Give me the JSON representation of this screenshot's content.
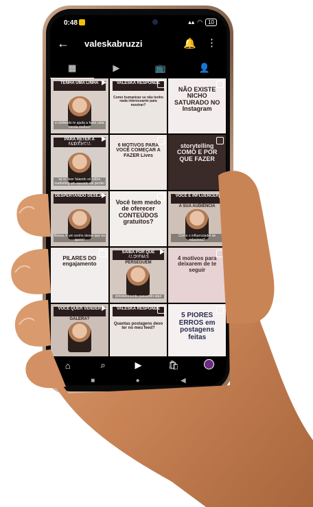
{
  "status": {
    "time": "0:48",
    "battery": "10"
  },
  "header": {
    "username": "valeskabruzzi",
    "back_icon": "←",
    "bell_icon": "🔔",
    "more_icon": "⋮"
  },
  "tabs": [
    {
      "name": "grid",
      "icon": "▦"
    },
    {
      "name": "reels",
      "icon": "▶"
    },
    {
      "name": "igtv",
      "icon": "📺"
    },
    {
      "name": "tagged",
      "icon": "👤"
    }
  ],
  "posts": [
    {
      "band": "TENHA UMA LINHA",
      "band2": "ATRAVÉS DO CONTEÚDO",
      "caption": "o conteúdo te ajuda a fazer uma venda melhor!",
      "bg": "#d9cfc8",
      "type": "photo"
    },
    {
      "band": "VALESKA RESPONDE",
      "big": "Como humanizar se não tenho nada interessante para mostrar?",
      "bg": "#ece6e3",
      "type": "text",
      "bigcolor": "#2b1d1d",
      "bigsize": 5
    },
    {
      "big": "NÃO EXISTE NICHO SATURADO NO Instagram",
      "bg": "#f3eded",
      "type": "text",
      "bigcolor": "#2b1d1d",
      "bigsize": 9
    },
    {
      "band": "PARA RETER A AUDIÊNCIA",
      "band2": "TENHA LINEARIDADE",
      "caption": "se vc tiver falando só sobre marketing um assunto vai perder",
      "bg": "#d6cfc9",
      "type": "photo"
    },
    {
      "big": "6 MOTIVOS PARA VOCÊ COMEÇAR A FAZER Lives",
      "bg": "#f1e9e6",
      "type": "text",
      "bigcolor": "#2b1d1d",
      "bigsize": 7
    },
    {
      "big": "storytelling COMO E POR QUE FAZER",
      "bg": "#3a2a28",
      "type": "text",
      "bigcolor": "#f4ede9",
      "bigsize": 9
    },
    {
      "band": "DESPERTANDO DESEJO",
      "band2": "ATRAVÉS DE IMAGENS",
      "caption": "Nossa, é um sonho desse que eu quero!",
      "bg": "#cfc3bb",
      "type": "photo"
    },
    {
      "big": "Você tem medo de oferecer CONTEÚDOS gratuitos?",
      "bg": "#f3efed",
      "type": "text",
      "bigcolor": "#2b1d1d",
      "bigsize": 9
    },
    {
      "band": "VOCÊ É INFLUENCER",
      "band2": "RELACIONAMENTO COM A SUA AUDIÊNCIA",
      "caption": "Como o influenciador se relaciona?",
      "bg": "#cfc1b8",
      "type": "photo"
    },
    {
      "big": "PILARES DO engajamento",
      "bg": "#f2eeed",
      "type": "text",
      "bigcolor": "#2b1d1d",
      "bigsize": 8
    },
    {
      "band": "SAIBA POR QUE ALGUMAS",
      "band2": "PROPAGANDAS TE PERSEGUEM",
      "caption": "provavelmente passando aqui",
      "bg": "#d4c8c1",
      "type": "photo"
    },
    {
      "big": "4 motivos para deixarem de te seguir",
      "bg": "#e8d3d4",
      "type": "text",
      "bigcolor": "#3a2a28",
      "bigsize": 8
    },
    {
      "band": "VOCÊ QUER VENDER",
      "band2": "OU ENTRETER A GALERA?",
      "caption": "",
      "bg": "#cbbfb7",
      "type": "photo"
    },
    {
      "band": "VALESKA RESPONDE",
      "big": "Quantas postagens devo ter no meu feed?",
      "bg": "#ece6e3",
      "type": "text",
      "bigcolor": "#2b1d1d",
      "bigsize": 6
    },
    {
      "big": "5 PIORES ERROS em postagens feitas",
      "bg": "#f4f1f0",
      "type": "text",
      "bigcolor": "#2b2d52",
      "bigsize": 10
    }
  ],
  "bottom_nav": [
    {
      "name": "home",
      "icon": "⌂"
    },
    {
      "name": "search",
      "icon": "⌕"
    },
    {
      "name": "reels",
      "icon": "▶"
    },
    {
      "name": "shop",
      "icon": "🛍"
    },
    {
      "name": "profile",
      "icon": ""
    }
  ],
  "system_nav": {
    "recents": "■",
    "home": "●",
    "back": "◀"
  }
}
